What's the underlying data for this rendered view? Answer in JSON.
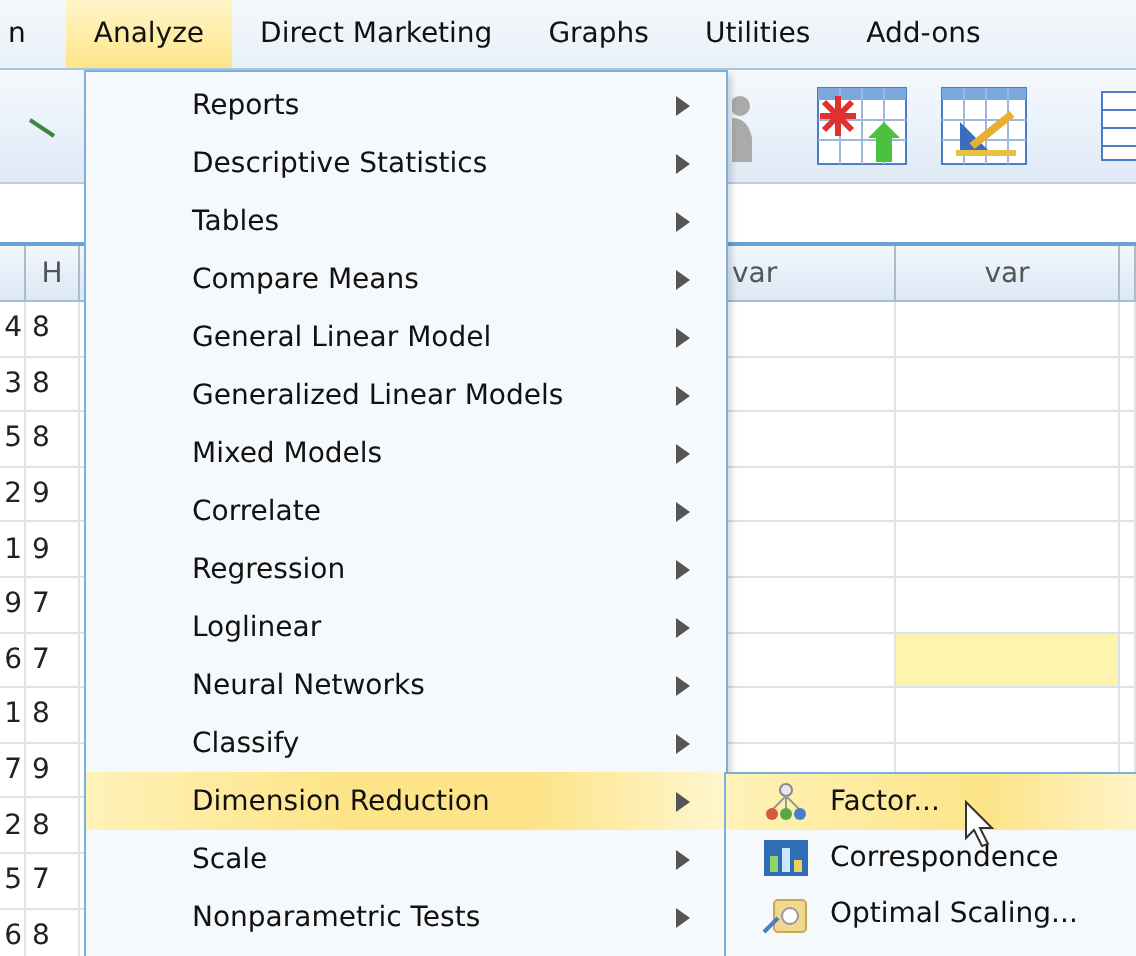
{
  "menubar": [
    {
      "label": "n",
      "selected": false
    },
    {
      "label": "Analyze",
      "selected": true
    },
    {
      "label": "Direct Marketing",
      "selected": false
    },
    {
      "label": "Graphs",
      "selected": false
    },
    {
      "label": "Utilities",
      "selected": false
    },
    {
      "label": "Add-ons",
      "selected": false
    }
  ],
  "grid": {
    "left_header": "H",
    "right_headers": [
      "var",
      "var"
    ],
    "rows": [
      {
        "column_1": "4",
        "column_2": "8",
        "highlighted": false
      },
      {
        "column_1": "3",
        "column_2": "8",
        "highlighted": false
      },
      {
        "column_1": "5",
        "column_2": "8",
        "highlighted": false
      },
      {
        "column_1": "2",
        "column_2": "9",
        "highlighted": false
      },
      {
        "column_1": "1",
        "column_2": "9",
        "highlighted": false
      },
      {
        "column_1": "9",
        "column_2": "7",
        "highlighted": false
      },
      {
        "column_1": "6",
        "column_2": "7",
        "highlighted": true
      },
      {
        "column_1": "1",
        "column_2": "8",
        "highlighted": false
      },
      {
        "column_1": "7",
        "column_2": "9"
      },
      {
        "column_1": "2",
        "column_2": "8"
      },
      {
        "column_1": "5",
        "column_2": "7"
      },
      {
        "column_1": "6",
        "column_2": "8"
      }
    ]
  },
  "analyze_menu": [
    {
      "label": "Reports",
      "submenu": true,
      "selected": false
    },
    {
      "label": "Descriptive Statistics",
      "submenu": true,
      "selected": false
    },
    {
      "label": "Tables",
      "submenu": true,
      "selected": false
    },
    {
      "label": "Compare Means",
      "submenu": true,
      "selected": false
    },
    {
      "label": "General Linear Model",
      "submenu": true,
      "selected": false
    },
    {
      "label": "Generalized Linear Models",
      "submenu": true,
      "selected": false
    },
    {
      "label": "Mixed Models",
      "submenu": true,
      "selected": false
    },
    {
      "label": "Correlate",
      "submenu": true,
      "selected": false
    },
    {
      "label": "Regression",
      "submenu": true,
      "selected": false
    },
    {
      "label": "Loglinear",
      "submenu": true,
      "selected": false
    },
    {
      "label": "Neural Networks",
      "submenu": true,
      "selected": false
    },
    {
      "label": "Classify",
      "submenu": true,
      "selected": false
    },
    {
      "label": "Dimension Reduction",
      "submenu": true,
      "selected": true
    },
    {
      "label": "Scale",
      "submenu": true,
      "selected": false
    },
    {
      "label": "Nonparametric Tests",
      "submenu": true,
      "selected": false
    }
  ],
  "dimension_reduction_menu": [
    {
      "label": "Factor...",
      "kind": "tree",
      "selected": true
    },
    {
      "label": "Correspondence",
      "kind": "chart",
      "selected": false
    },
    {
      "label": "Optimal Scaling...",
      "kind": "scaling",
      "selected": false
    }
  ]
}
